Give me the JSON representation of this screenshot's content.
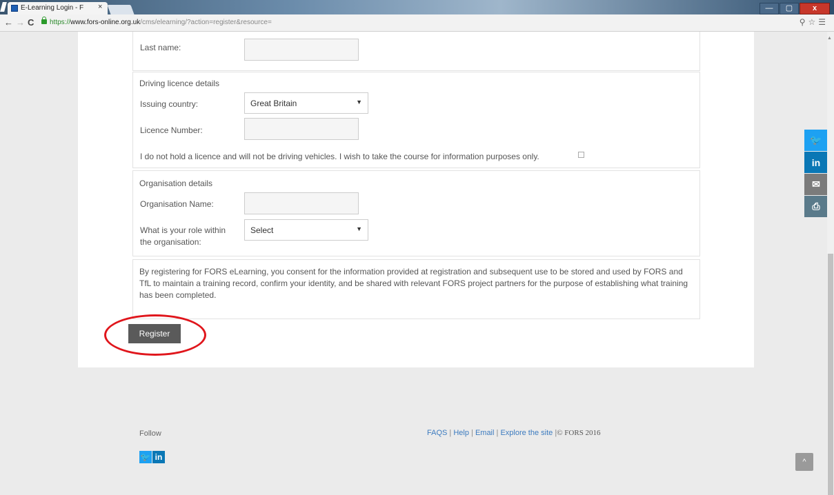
{
  "browser": {
    "tab_title": "E-Learning Login - F",
    "tab_close": "×",
    "url_proto": "https://",
    "url_host": "www.fors-online.org.uk",
    "url_path": "/cms/elearning/?action=register&resource=",
    "win_minimize": "—",
    "win_restore": "▢",
    "win_close": "x"
  },
  "form": {
    "last_name_label": "Last name:",
    "licence_section_title": "Driving licence details",
    "issuing_country_label": "Issuing country:",
    "issuing_country_value": "Great Britain",
    "licence_number_label": "Licence Number:",
    "no_licence_text": "I do not hold a licence and will not be driving vehicles. I wish to take the course for information purposes only.",
    "org_section_title": "Organisation details",
    "org_name_label": "Organisation Name:",
    "role_label_line1": "What is your role within",
    "role_label_line2": "the organisation:",
    "role_value": "Select",
    "consent_text": "By registering for FORS eLearning, you consent for the information provided at registration and subsequent use to be stored and used by FORS and TfL to maintain a training record, confirm your identity, and be shared with relevant FORS project partners for the purpose of establishing what training has been completed.",
    "register_label": "Register"
  },
  "share": {
    "twitter_glyph": "🐦",
    "linkedin_glyph": "in",
    "email_glyph": "✉",
    "print_glyph": "⎙",
    "colors": {
      "twitter": "#1da1f2",
      "linkedin": "#0a77b5",
      "email": "#7b7b7b",
      "print": "#5a7a8a"
    }
  },
  "footer": {
    "follow_label": "Follow",
    "twitter_glyph": "🐦",
    "linkedin_glyph": "in",
    "faqs": "FAQS",
    "help": "Help",
    "email": "Email",
    "explore": "Explore the site",
    "copyright": "© FORS 2016"
  },
  "colors": {
    "accent_red_annotation": "#e0161c",
    "button_bg": "#5a5a5a",
    "link": "#3c7bbf"
  }
}
